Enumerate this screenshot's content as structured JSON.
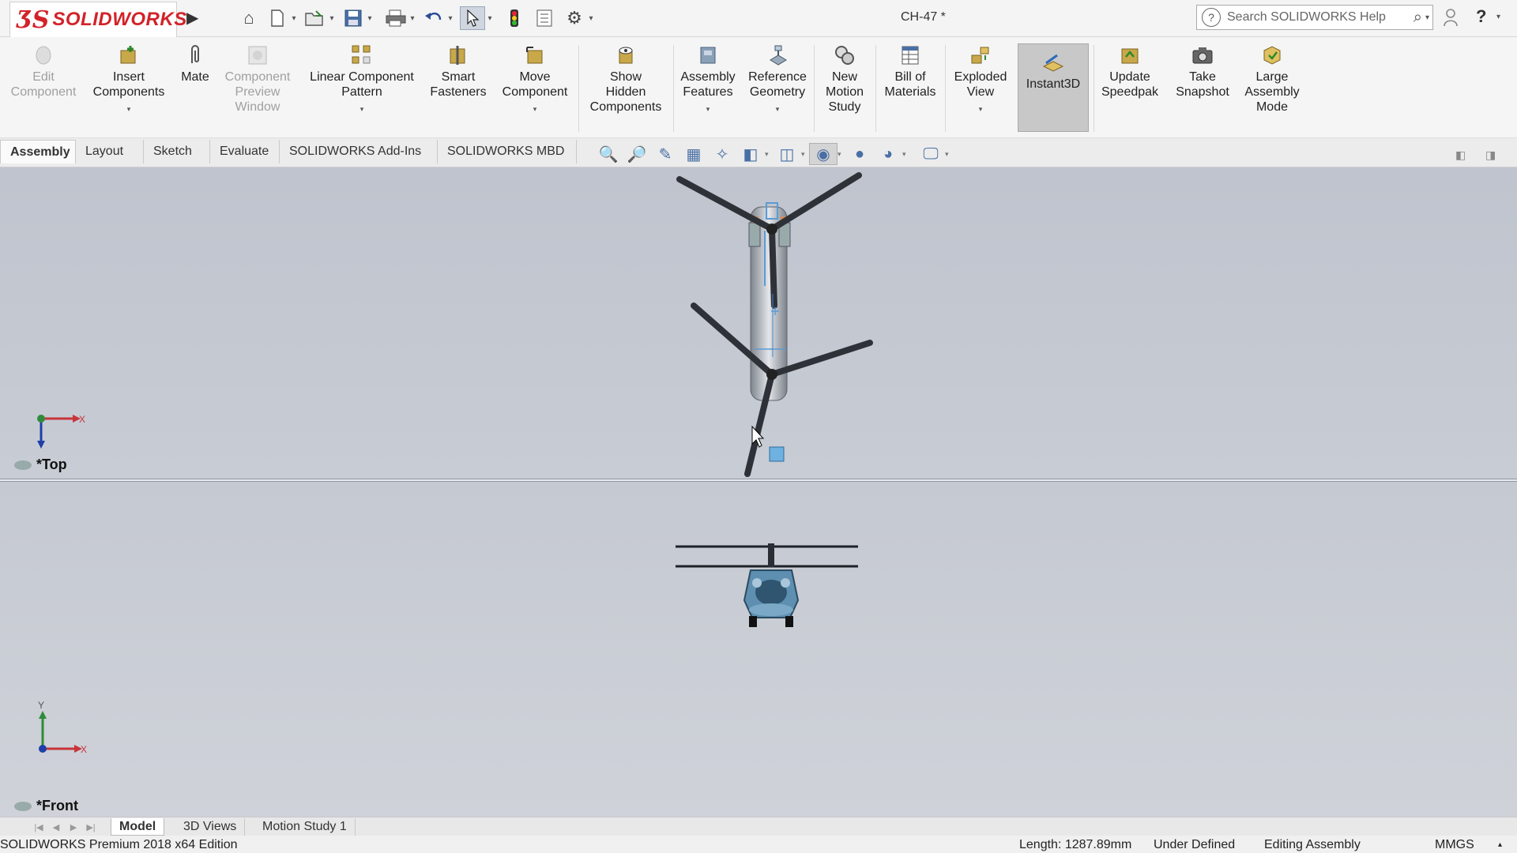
{
  "app": {
    "brand_ds": "3S",
    "brand_name": "SOLIDWORKS",
    "document_title": "CH-47 *",
    "search_placeholder": "Search SOLIDWORKS Help"
  },
  "quick_access": [
    {
      "icon": "home-icon",
      "glyph": "⌂"
    },
    {
      "icon": "new-document-icon",
      "glyph": "🗋"
    },
    {
      "icon": "open-folder-icon",
      "glyph": "📂"
    },
    {
      "icon": "save-icon",
      "glyph": "💾"
    },
    {
      "icon": "print-icon",
      "glyph": "🖶"
    },
    {
      "icon": "undo-icon",
      "glyph": "↶"
    },
    {
      "icon": "select-pointer-icon",
      "glyph": "➚"
    },
    {
      "icon": "rebuild-icon",
      "glyph": "🚦"
    },
    {
      "icon": "file-properties-icon",
      "glyph": "☰"
    },
    {
      "icon": "options-gear-icon",
      "glyph": "⚙"
    }
  ],
  "ribbon": {
    "edit_component": "Edit\nComponent",
    "insert_components": "Insert\nComponents",
    "mate": "Mate",
    "component_preview_window": "Component\nPreview\nWindow",
    "linear_component_pattern": "Linear Component\nPattern",
    "smart_fasteners": "Smart\nFasteners",
    "move_component": "Move\nComponent",
    "show_hidden_components": "Show\nHidden\nComponents",
    "assembly_features": "Assembly\nFeatures",
    "reference_geometry": "Reference\nGeometry",
    "new_motion_study": "New\nMotion\nStudy",
    "bill_of_materials": "Bill of\nMaterials",
    "exploded_view": "Exploded\nView",
    "instant3d": "Instant3D",
    "update_speedpak": "Update\nSpeedpak",
    "take_snapshot": "Take\nSnapshot",
    "large_assembly_mode": "Large\nAssembly\nMode"
  },
  "command_tabs": [
    "Assembly",
    "Layout",
    "Sketch",
    "Evaluate",
    "SOLIDWORKS Add-Ins",
    "SOLIDWORKS MBD"
  ],
  "viewports": {
    "top_label": "*Top",
    "front_label": "*Front",
    "triad_x": "X",
    "triad_y": "Y"
  },
  "bottom_tabs": [
    "Model",
    "3D Views",
    "Motion Study 1"
  ],
  "status": {
    "edition": "SOLIDWORKS Premium 2018 x64 Edition",
    "length": "Length: 1287.89mm",
    "state": "Under Defined",
    "mode": "Editing Assembly",
    "units": "MMGS"
  },
  "colors": {
    "brand_red": "#d2232a",
    "viewport_bg": "#c5c9d1",
    "triad_x": "#c8343a",
    "triad_y": "#2e8b3a",
    "triad_z": "#1f3fa8"
  }
}
